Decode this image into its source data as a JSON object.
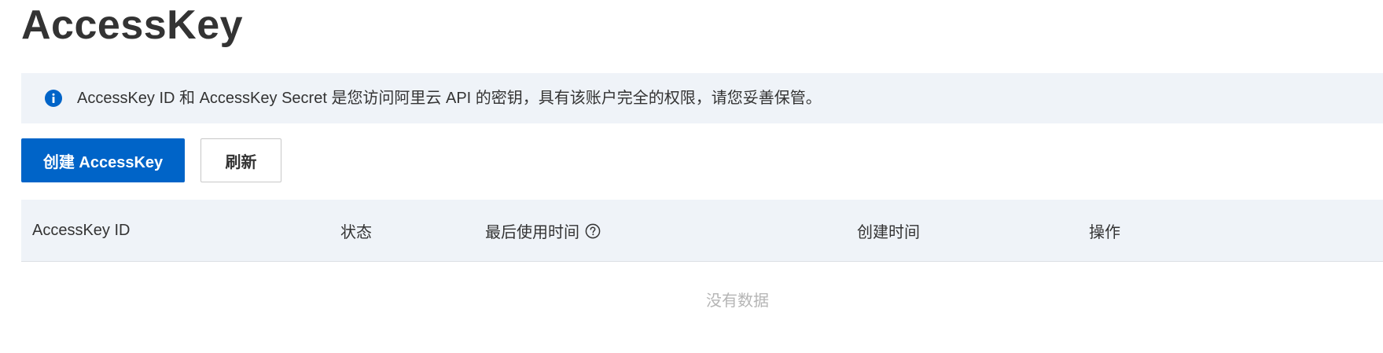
{
  "page": {
    "title": "AccessKey"
  },
  "notice": {
    "icon": "info-icon",
    "text": "AccessKey ID 和 AccessKey Secret 是您访问阿里云 API 的密钥，具有该账户完全的权限，请您妥善保管。",
    "icon_color": "#0064c8",
    "background": "#eff3f8"
  },
  "toolbar": {
    "create_label": "创建 AccessKey",
    "refresh_label": "刷新",
    "primary_color": "#0064c8"
  },
  "table": {
    "columns": [
      {
        "label": "AccessKey ID"
      },
      {
        "label": "状态"
      },
      {
        "label": "最后使用时间",
        "icon": "help-icon"
      },
      {
        "label": "创建时间"
      },
      {
        "label": "操作"
      }
    ],
    "empty_text": "没有数据"
  }
}
